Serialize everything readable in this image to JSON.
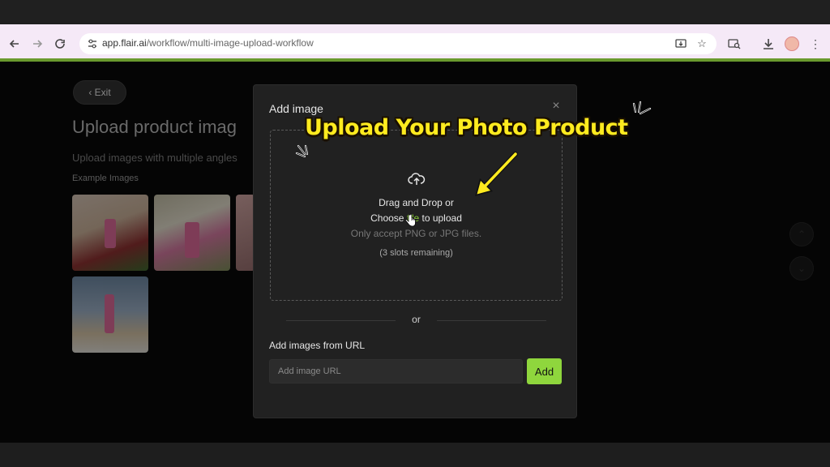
{
  "browser": {
    "url_host": "app.flair.ai",
    "url_path": "/workflow/multi-image-upload-workflow",
    "icons": [
      "back-icon",
      "forward-icon",
      "reload-icon",
      "site-info-icon",
      "install-app-icon",
      "bookmark-star-icon",
      "lens-icon",
      "download-icon",
      "profile-avatar",
      "more-menu-icon"
    ]
  },
  "page": {
    "exit_label": "Exit",
    "title": "Upload product imag",
    "subtitle": "Upload images with multiple angles",
    "examples_label": "Example Images"
  },
  "modal": {
    "title": "Add image",
    "drop_line1": "Drag and Drop or",
    "drop_choose": "Choose ",
    "drop_link": "file",
    "drop_to_upload": " to upload",
    "drop_accept": "Only accept PNG or JPG files.",
    "drop_slots": "(3 slots remaining)",
    "or_text": "or",
    "url_label": "Add images from URL",
    "url_placeholder": "Add image URL",
    "add_button": "Add"
  },
  "overlay": {
    "caption": "Upload Your Photo Product",
    "caption_color": "#ffeb1f",
    "arrow_color": "#ffeb1f"
  },
  "colors": {
    "accent_green": "#8fd63d",
    "browser_chrome": "#f5e9f7",
    "modal_bg": "#212121"
  }
}
